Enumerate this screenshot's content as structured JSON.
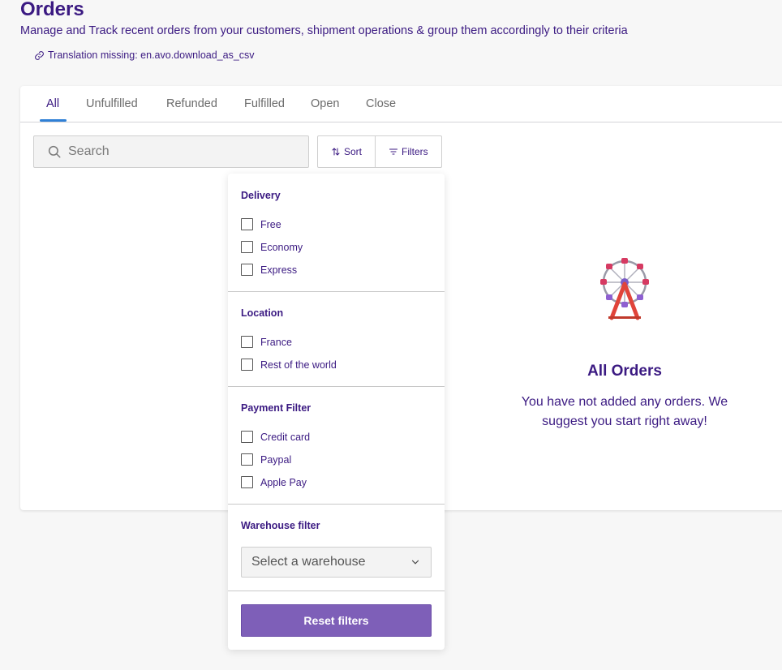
{
  "header": {
    "title": "Orders",
    "subtitle": "Manage and Track recent orders from your customers, shipment operations & group them accordingly to their criteria",
    "csv_link": "Translation missing: en.avo.download_as_csv"
  },
  "tabs": [
    {
      "label": "All",
      "active": true
    },
    {
      "label": "Unfulfilled"
    },
    {
      "label": "Refunded"
    },
    {
      "label": "Fulfilled"
    },
    {
      "label": "Open"
    },
    {
      "label": "Close"
    }
  ],
  "search": {
    "placeholder": "Search"
  },
  "toolbar": {
    "sort_label": "Sort",
    "filters_label": "Filters"
  },
  "empty_state": {
    "title": "All Orders",
    "text": "You have not added any orders. We suggest you start right away!"
  },
  "filters": {
    "delivery": {
      "heading": "Delivery",
      "options": [
        "Free",
        "Economy",
        "Express"
      ]
    },
    "location": {
      "heading": "Location",
      "options": [
        "France",
        "Rest of the world"
      ]
    },
    "payment": {
      "heading": "Payment Filter",
      "options": [
        "Credit card",
        "Paypal",
        "Apple Pay"
      ]
    },
    "warehouse": {
      "heading": "Warehouse filter",
      "placeholder": "Select a warehouse"
    },
    "reset_label": "Reset filters"
  },
  "colors": {
    "accent": "#3b1a82",
    "tab_indicator": "#2f80d6",
    "reset_button": "#7e5fb8"
  }
}
